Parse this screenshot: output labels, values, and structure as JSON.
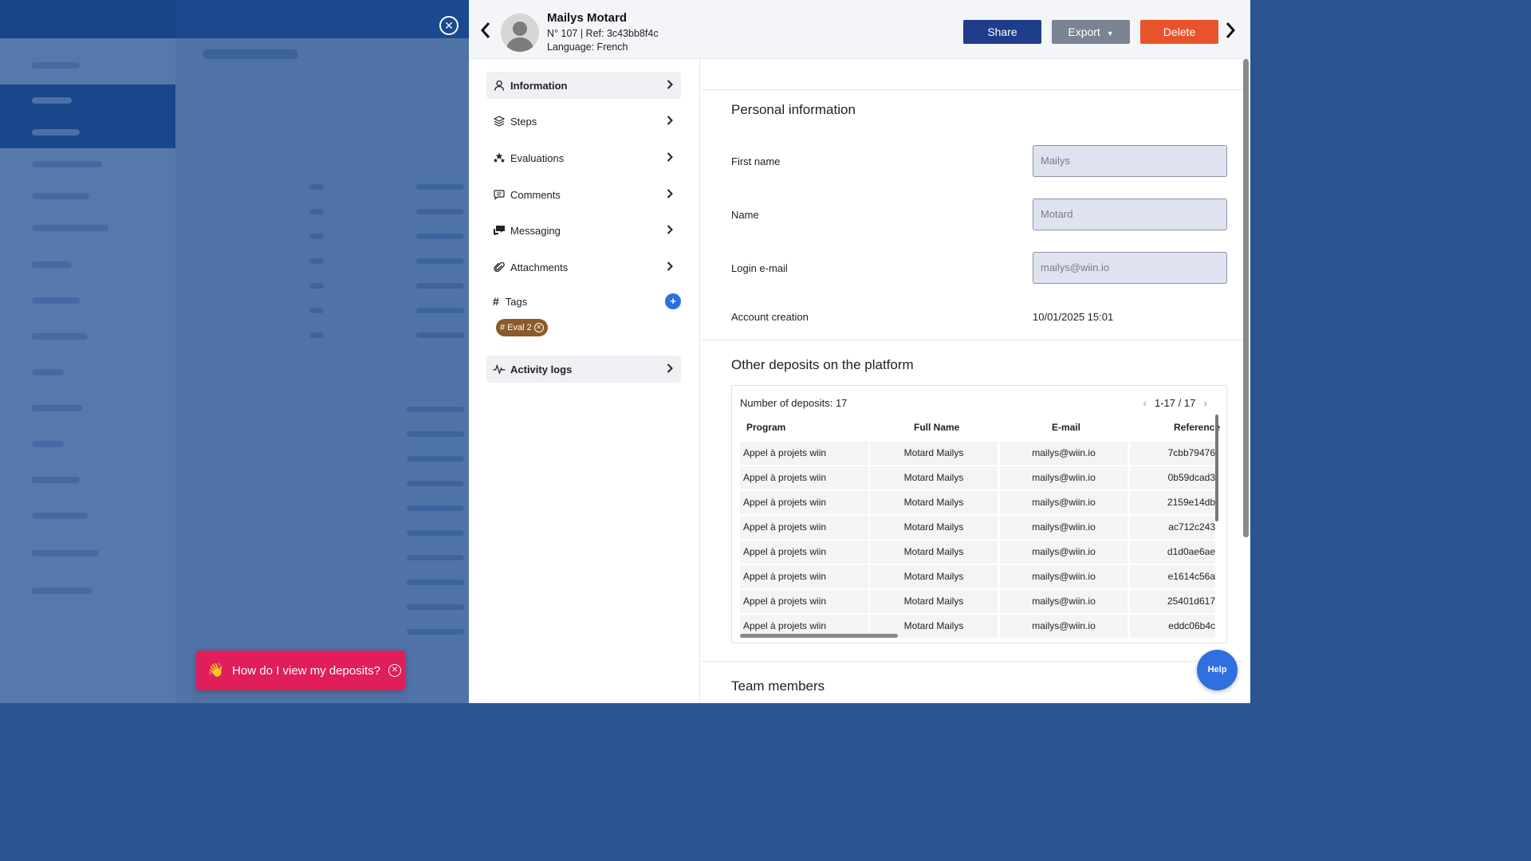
{
  "overlay": {
    "close_icon": "close-circle-icon"
  },
  "help_toast": {
    "icon": "waving-hand-icon",
    "emoji": "👋",
    "text": "How do I view my deposits?",
    "close_icon": "close-circle-icon"
  },
  "header": {
    "name": "Mailys Motard",
    "ref": "N° 107 | Ref: 3c43bb8f4c",
    "language": "Language: French",
    "share_label": "Share",
    "export_label": "Export",
    "delete_label": "Delete",
    "colors": {
      "share": "#1f3d8a",
      "export": "#7b8493",
      "delete": "#e8532b"
    }
  },
  "leftnav": {
    "items": [
      {
        "label": "Information",
        "icon": "user-icon"
      },
      {
        "label": "Steps",
        "icon": "layers-icon"
      },
      {
        "label": "Evaluations",
        "icon": "stars-icon"
      },
      {
        "label": "Comments",
        "icon": "comment-icon"
      },
      {
        "label": "Messaging",
        "icon": "messaging-icon"
      },
      {
        "label": "Attachments",
        "icon": "paperclip-icon"
      }
    ],
    "tags_label": "Tags",
    "tags": [
      {
        "label": "# Eval 2",
        "color": "#8a5a2b"
      }
    ],
    "activity_label": "Activity logs"
  },
  "personal": {
    "title": "Personal information",
    "first_name_label": "First name",
    "first_name_value": "Mailys",
    "name_label": "Name",
    "name_value": "Motard",
    "email_label": "Login e-mail",
    "email_value": "mailys@wiin.io",
    "creation_label": "Account creation",
    "creation_value": "10/01/2025 15:01"
  },
  "deposits": {
    "title": "Other deposits on the platform",
    "count": "Number of deposits: 17",
    "pager": "1-17 / 17",
    "columns": [
      "Program",
      "Full Name",
      "E-mail",
      "Reference"
    ],
    "rows": [
      [
        "Appel à projets wiin",
        "Motard Mailys",
        "mailys@wiin.io",
        "7cbb79476"
      ],
      [
        "Appel à projets wiin",
        "Motard Mailys",
        "mailys@wiin.io",
        "0b59dcad3"
      ],
      [
        "Appel à projets wiin",
        "Motard Mailys",
        "mailys@wiin.io",
        "2159e14db"
      ],
      [
        "Appel à projets wiin",
        "Motard Mailys",
        "mailys@wiin.io",
        "ac712c243"
      ],
      [
        "Appel à projets wiin",
        "Motard Mailys",
        "mailys@wiin.io",
        "d1d0ae6ae"
      ],
      [
        "Appel à projets wiin",
        "Motard Mailys",
        "mailys@wiin.io",
        "e1614c56a"
      ],
      [
        "Appel à projets wiin",
        "Motard Mailys",
        "mailys@wiin.io",
        "25401d617"
      ],
      [
        "Appel à projets wiin",
        "Motard Mailys",
        "mailys@wiin.io",
        "eddc06b4c"
      ]
    ]
  },
  "team": {
    "title": "Team members"
  },
  "help_button": {
    "label": "Help"
  }
}
